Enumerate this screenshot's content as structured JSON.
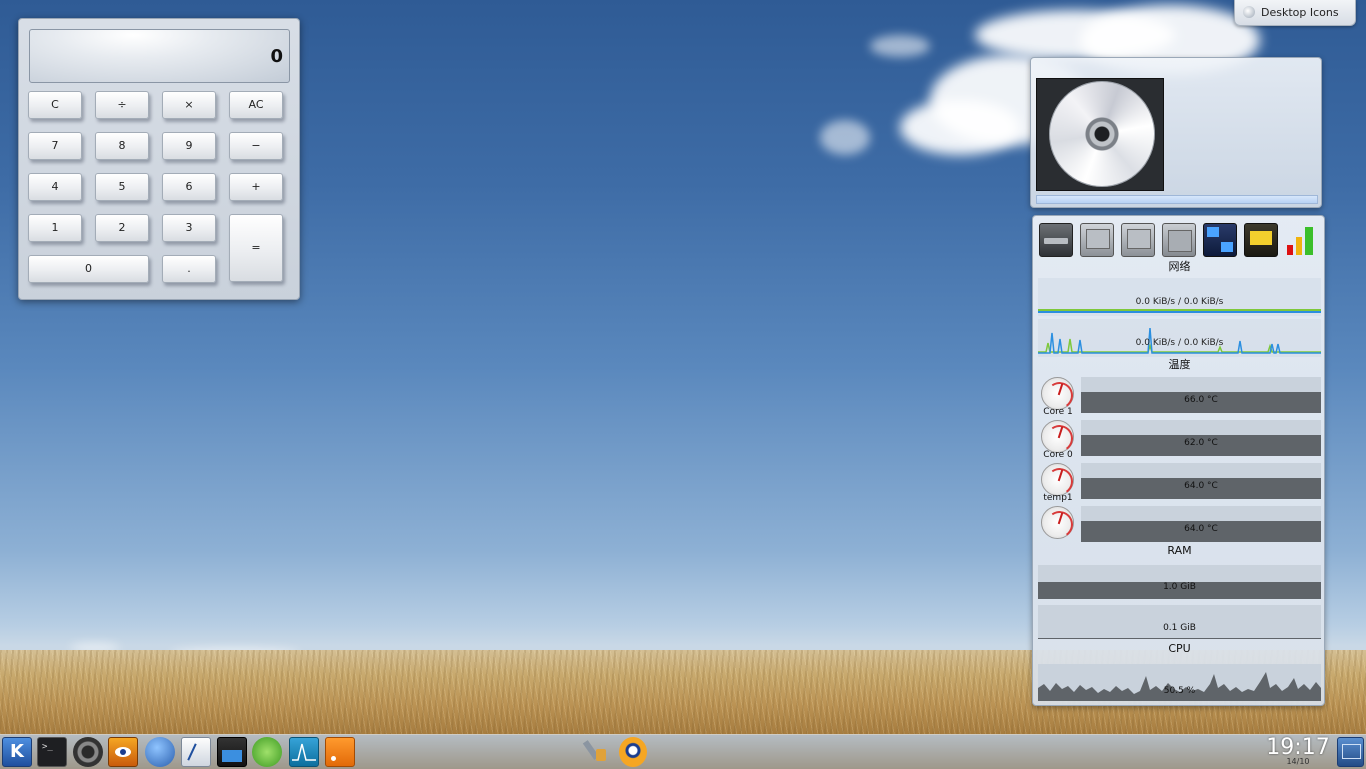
{
  "desktop_toolbox": {
    "label": "Desktop Icons"
  },
  "calculator": {
    "display": "0",
    "buttons": {
      "clear": "C",
      "divide": "÷",
      "multiply": "×",
      "all_clear": "AC",
      "seven": "7",
      "eight": "8",
      "nine": "9",
      "minus": "−",
      "four": "4",
      "five": "5",
      "six": "6",
      "plus": "+",
      "one": "1",
      "two": "2",
      "three": "3",
      "equals": "=",
      "zero": "0",
      "decimal": "."
    }
  },
  "media_player": {
    "progress": 0.0,
    "art_icon": "optical-disc-icon"
  },
  "system_monitor": {
    "tools": [
      "hard-disk-icon",
      "monitor-icon",
      "monitor-icon",
      "hardware-icon",
      "network-icon",
      "memory-chip-icon",
      "signal-bars-icon"
    ],
    "network": {
      "heading": "网络",
      "interfaces": [
        {
          "rate": "0.0 KiB/s / 0.0 KiB/s"
        },
        {
          "rate": "0.0 KiB/s / 0.0 KiB/s"
        }
      ]
    },
    "temperature": {
      "heading": "温度",
      "sensors": [
        {
          "name": "Core 1",
          "value": "66.0 °C"
        },
        {
          "name": "Core 0",
          "value": "62.0 °C"
        },
        {
          "name": "temp1",
          "value": "64.0 °C"
        },
        {
          "name": "",
          "value": "64.0 °C"
        }
      ]
    },
    "ram": {
      "heading": "RAM",
      "used": "1.0 GiB",
      "swap": "0.1 GiB"
    },
    "cpu": {
      "heading": "CPU",
      "usage": "50.5 %"
    }
  },
  "taskbar": {
    "apps": [
      "kde-menu-icon",
      "terminal-icon",
      "webcam-icon",
      "eye-viewer-icon",
      "web-browser-icon",
      "writer-icon",
      "video-editor-icon",
      "android-icon",
      "waveform-icon",
      "rss-icon"
    ],
    "tray": [
      "tools-icon",
      "update-icon"
    ],
    "clock": "19:17",
    "date": "14/10",
    "show_desktop": "show-desktop-icon"
  }
}
